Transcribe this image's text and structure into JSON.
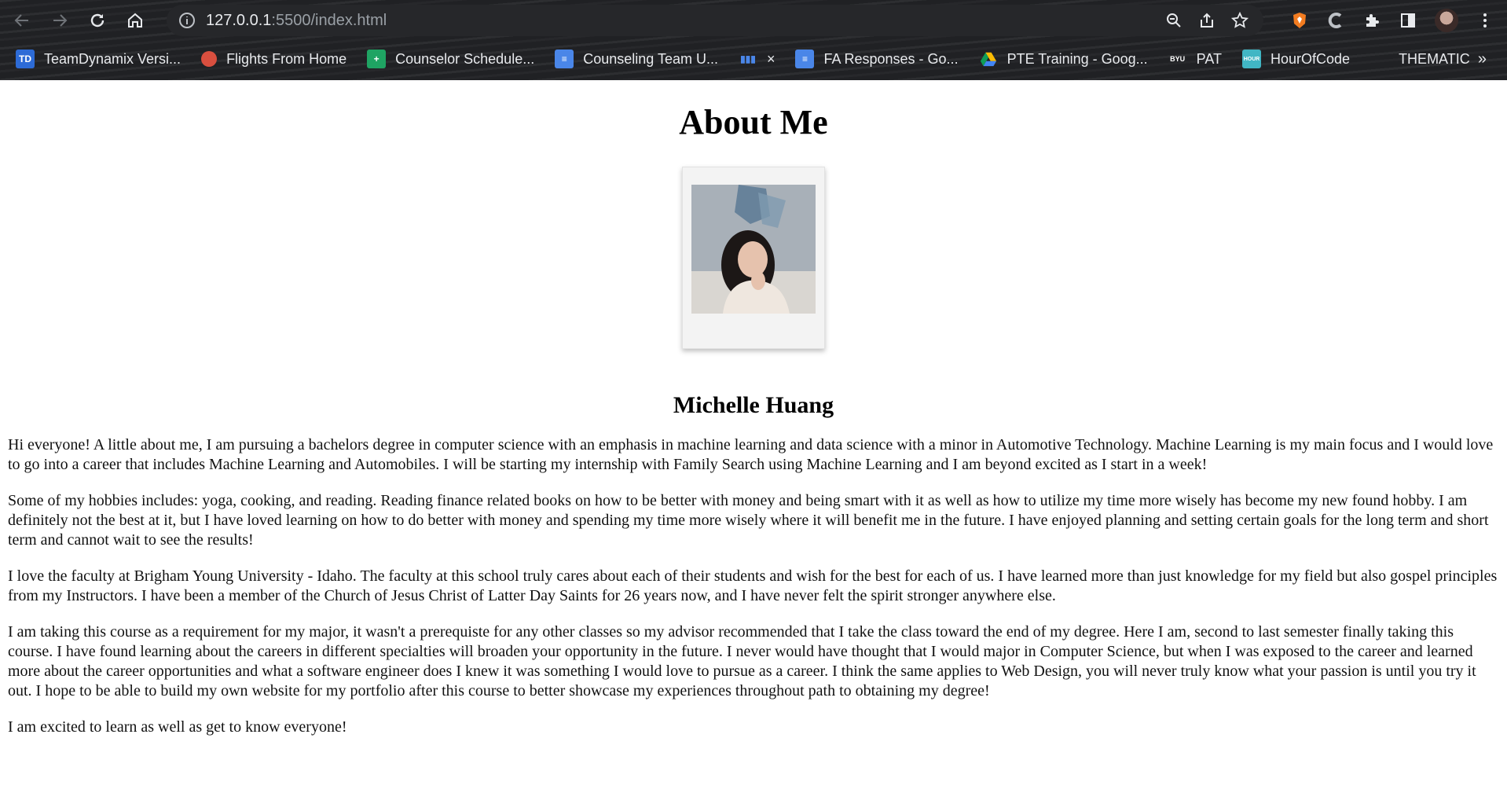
{
  "browser": {
    "url_host": "127.0.0.1",
    "url_path": ":5500/index.html",
    "bookmarks": [
      {
        "label": "TeamDynamix Versi...",
        "icon": "td-icon"
      },
      {
        "label": "Flights From Home",
        "icon": "flights-icon"
      },
      {
        "label": "Counselor Schedule...",
        "icon": "sheets-icon"
      },
      {
        "label": "Counseling Team U...",
        "icon": "docs-icon"
      },
      {
        "label": "×",
        "icon": "chart-icon"
      },
      {
        "label": "FA Responses - Go...",
        "icon": "docs-icon"
      },
      {
        "label": "PTE Training - Goog...",
        "icon": "drive-icon"
      },
      {
        "label": "PAT",
        "icon": "byu-icon"
      },
      {
        "label": "HourOfCode",
        "icon": "hourofcode-icon"
      },
      {
        "label": "THEMATIC",
        "icon": ""
      }
    ],
    "more_label": "»"
  },
  "page": {
    "title": "About Me",
    "name": "Michelle Huang",
    "paragraphs": [
      "Hi everyone! A little about me, I am pursuing a bachelors degree in computer science with an emphasis in machine learning and data science with a minor in Automotive Technology. Machine Learning is my main focus and I would love to go into a career that includes Machine Learning and Automobiles. I will be starting my internship with Family Search using Machine Learning and I am beyond excited as I start in a week!",
      "Some of my hobbies includes: yoga, cooking, and reading. Reading finance related books on how to be better with money and being smart with it as well as how to utilize my time more wisely has become my new found hobby. I am definitely not the best at it, but I have loved learning on how to do better with money and spending my time more wisely where it will benefit me in the future. I have enjoyed planning and setting certain goals for the long term and short term and cannot wait to see the results!",
      "I love the faculty at Brigham Young University - Idaho. The faculty at this school truly cares about each of their students and wish for the best for each of us. I have learned more than just knowledge for my field but also gospel principles from my Instructors. I have been a member of the Church of Jesus Christ of Latter Day Saints for 26 years now, and I have never felt the spirit stronger anywhere else.",
      "I am taking this course as a requirement for my major, it wasn't a prerequiste for any other classes so my advisor recommended that I take the class toward the end of my degree. Here I am, second to last semester finally taking this course. I have found learning about the careers in different specialties will broaden your opportunity in the future. I never would have thought that I would major in Computer Science, but when I was exposed to the career and learned more about the career opportunities and what a software engineer does I knew it was something I would love to pursue as a career. I think the same applies to Web Design, you will never truly know what your passion is until you try it out. I hope to be able to build my own website for my portfolio after this course to better showcase my experiences throughout path to obtaining my degree!",
      "I am excited to learn as well as get to know everyone!"
    ]
  }
}
